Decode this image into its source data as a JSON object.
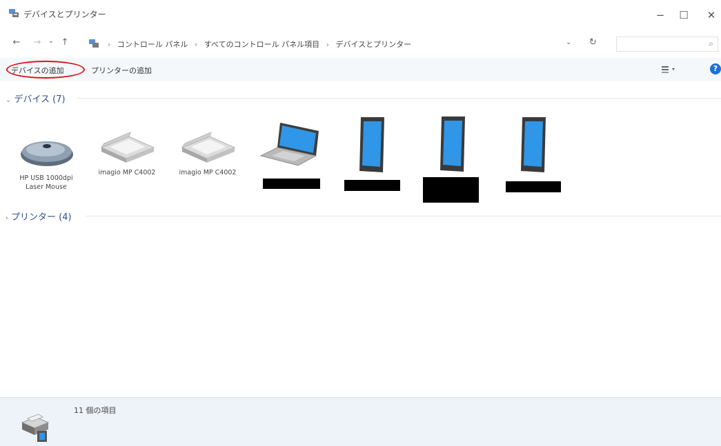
{
  "window": {
    "title": "デバイスとプリンター",
    "minimize": "−",
    "maximize": "☐",
    "close": "✕"
  },
  "nav": {
    "back": "←",
    "forward": "→",
    "recent": "⌄",
    "up": "↑"
  },
  "address": {
    "crumbs": [
      "コントロール パネル",
      "すべてのコントロール パネル項目",
      "デバイスとプリンター"
    ],
    "separator": "›",
    "dropdown": "⌄",
    "refresh": "↻"
  },
  "search": {
    "icon": "search-icon",
    "glyph": "⌕"
  },
  "commands": {
    "add_device": "デバイスの追加",
    "add_printer": "プリンターの追加",
    "help": "?"
  },
  "groups": {
    "devices": {
      "label": "デバイス (7)",
      "chevron": "⌄"
    },
    "printers": {
      "label": "プリンター (4)",
      "chevron": "›"
    }
  },
  "devices": [
    {
      "icon": "mouse-icon",
      "label": "HP USB 1000dpi Laser Mouse"
    },
    {
      "icon": "scanner-icon",
      "label": "imagio MP C4002"
    },
    {
      "icon": "scanner-icon",
      "label": "imagio MP C4002"
    },
    {
      "icon": "laptop-icon",
      "label": ""
    },
    {
      "icon": "phone-icon",
      "label": ""
    },
    {
      "icon": "phone-icon",
      "label": ""
    },
    {
      "icon": "phone-icon",
      "label": ""
    }
  ],
  "status": {
    "count_text": "11 個の項目",
    "icon": "printer-icon"
  },
  "colors": {
    "accent": "#1e6fd9",
    "highlight": "#e0141a",
    "group_header": "#2c4f86"
  }
}
